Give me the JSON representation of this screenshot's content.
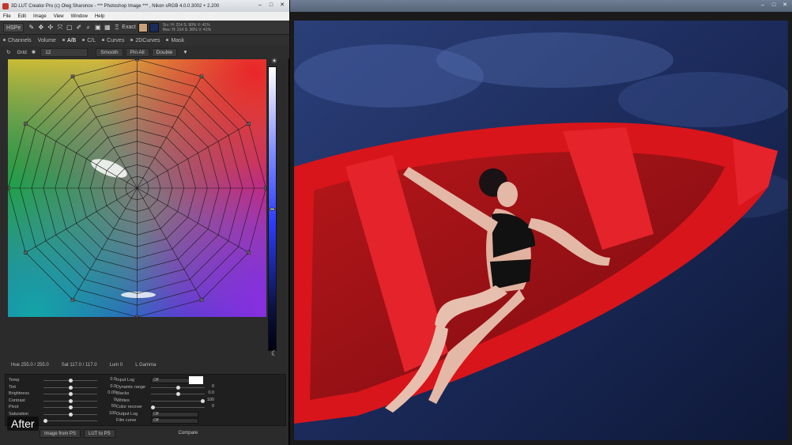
{
  "app": {
    "title": "3D LUT Creator Pro (c) Oleg Sharonov - *** Photoshop Image *** , Nikon sRGB 4.0.0.3002 + 2.200",
    "menu": [
      "File",
      "Edit",
      "Image",
      "View",
      "Window",
      "Help"
    ],
    "toolbar": {
      "mode": "HSPe",
      "exact_label": "Exact",
      "readout_line1": "Src: H: 214  S: 90%  V: 41%",
      "readout_line2": "Res: H: 214  S: 90%  V: 41%",
      "swatch_src_color": "#c9a07a",
      "swatch_res_color": "#1a2a5a"
    },
    "tabs": [
      {
        "label": "Channels"
      },
      {
        "label": "Volume"
      },
      {
        "label": "A/B",
        "active": true
      },
      {
        "label": "C/L"
      },
      {
        "label": "Curves"
      },
      {
        "label": "2DCurves"
      },
      {
        "label": "Mask"
      }
    ],
    "options": {
      "grid_label": "Grid",
      "grid_value": "12",
      "smooth_label": "Smooth",
      "pin_all_label": "Pin All",
      "double_label": "Double"
    },
    "status": {
      "hue": "Hue 255.0 / 255.0",
      "sat": "Sat 117.0 / 117.0",
      "lum": "Lum  0",
      "mode": "L  Gamma"
    },
    "adjust_left": [
      {
        "label": "Temp",
        "value": "0.0",
        "pos": 0.5
      },
      {
        "label": "Tint",
        "value": "0.0",
        "pos": 0.5
      },
      {
        "label": "Brightness",
        "value": "0.00",
        "pos": 0.5
      },
      {
        "label": "Contrast",
        "value": "0",
        "pos": 0.5
      },
      {
        "label": "Pivot",
        "value": "50",
        "pos": 0.5
      },
      {
        "label": "Saturation",
        "value": "100",
        "pos": 0.5
      },
      {
        "label": "",
        "value": "",
        "pos": 0.0
      }
    ],
    "adjust_right": [
      {
        "label": "Input Log",
        "dropdown": "Off"
      },
      {
        "label": "Dynamic range",
        "value": "0",
        "pos": 0.5
      },
      {
        "label": "Blacks",
        "value": "0.0",
        "pos": 0.5
      },
      {
        "label": "Whites",
        "value": "100",
        "pos": 0.99
      },
      {
        "label": "Color recover",
        "value": "0",
        "pos": 0.0
      },
      {
        "label": "Output Log",
        "dropdown": "Off"
      },
      {
        "label": "Film curve",
        "dropdown": "Off"
      }
    ],
    "bottom": {
      "image_from_ps": "Image from PS",
      "lut_to_ps": "LUT to PS",
      "compare": "Compare"
    },
    "after_label": "After"
  }
}
